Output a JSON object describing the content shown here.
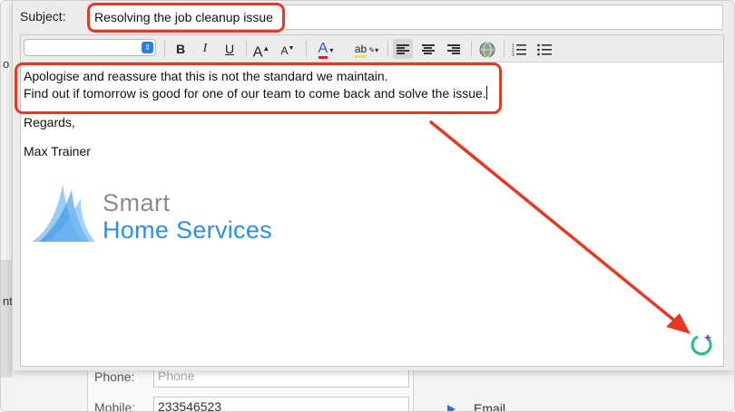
{
  "background": {
    "left_text": "o",
    "left_text2": "nt",
    "form": {
      "phone_label": "Phone:",
      "phone_placeholder": "Phone",
      "mobile_label": "Mobile:",
      "mobile_value": "233546523"
    },
    "email_label": "Email"
  },
  "dialog": {
    "subject_label": "Subject:",
    "subject_value": "Resolving the job cleanup issue"
  },
  "toolbar": {
    "bold": "B",
    "italic": "I",
    "underline": "U",
    "grow_font": "A",
    "shrink_font": "A",
    "font_color": "A",
    "highlight": "ab",
    "icons": [
      "chevron-updown-icon",
      "bold-icon",
      "italic-icon",
      "underline-icon",
      "grow-font-icon",
      "shrink-font-icon",
      "font-color-icon",
      "highlight-icon",
      "align-left-icon",
      "align-center-icon",
      "align-right-icon",
      "insert-link-icon",
      "numbered-list-icon",
      "bulleted-list-icon"
    ]
  },
  "email_body": {
    "line1": "Apologise and reassure that this is not the standard we maintain.",
    "line2": "Find out if tomorrow is good for one of our team to come back and solve the issue.",
    "regards": "Regards,",
    "signer": "Max Trainer"
  },
  "logo": {
    "line1": "Smart",
    "line2": "Home Services"
  },
  "colors": {
    "annotation": "#e43a25",
    "logo_blue": "#2f8fe0",
    "logo_gray": "#8b8b8b",
    "ai_icon_green": "#2cbf8a",
    "ai_icon_purple": "#7a4cd0"
  }
}
